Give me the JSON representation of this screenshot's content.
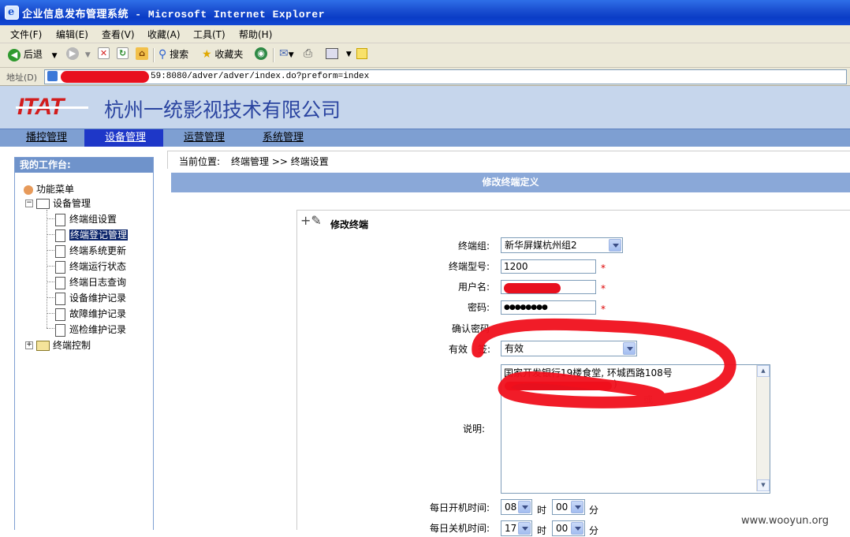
{
  "window": {
    "title": "企业信息发布管理系统 - Microsoft Internet Explorer",
    "accent": "#1b4fd1"
  },
  "menubar": [
    "文件(F)",
    "编辑(E)",
    "查看(V)",
    "收藏(A)",
    "工具(T)",
    "帮助(H)"
  ],
  "toolbar": {
    "back_label": "后退",
    "search_label": "搜索",
    "favorites_label": "收藏夹"
  },
  "address": {
    "label": "地址(D)",
    "url_visible": "59:8080/adver/adver/index.do?preform=index"
  },
  "header": {
    "logo": "ITAT",
    "company": "杭州一统影视技术有限公司"
  },
  "nav": {
    "tabs": [
      "播控管理",
      "设备管理",
      "运营管理",
      "系统管理"
    ],
    "active": "设备管理"
  },
  "sidebar": {
    "title": "我的工作台:",
    "root": "功能菜单",
    "group": "设备管理",
    "items": [
      "终端组设置",
      "终端登记管理",
      "终端系统更新",
      "终端运行状态",
      "终端日志查询",
      "设备维护记录",
      "故障维护记录",
      "巡检维护记录"
    ],
    "selected": "终端登记管理",
    "group2": "终端控制"
  },
  "breadcrumb": {
    "prefix": "当前位置:",
    "path": "终端管理 >> 终端设置"
  },
  "section_title": "修改终端定义",
  "form": {
    "title": "修改终端",
    "group_label": "终端组:",
    "group_value": "新华屏媒杭州组2",
    "model_label": "终端型号:",
    "model_value": "1200",
    "username_label": "用户名:",
    "password_label": "密码:",
    "password_value": "●●●●●●●●",
    "confirm_label": "确认密码",
    "valid_label": "有效",
    "valid_label_tail": "签:",
    "valid_value": "有效",
    "remark_label": "说明:",
    "remark_text": "国家开发银行19楼食堂, 环城西路108号",
    "remark_tail": ")",
    "remark_tail2": "或",
    "start_label": "每日开机时间:",
    "start_hour": "08",
    "start_min": "00",
    "hour_unit": "时",
    "min_unit": "分",
    "stop_label": "每日关机时间:",
    "stop_hour": "17",
    "stop_min": "00",
    "required_mark": "*"
  },
  "watermark": "www.wooyun.org"
}
